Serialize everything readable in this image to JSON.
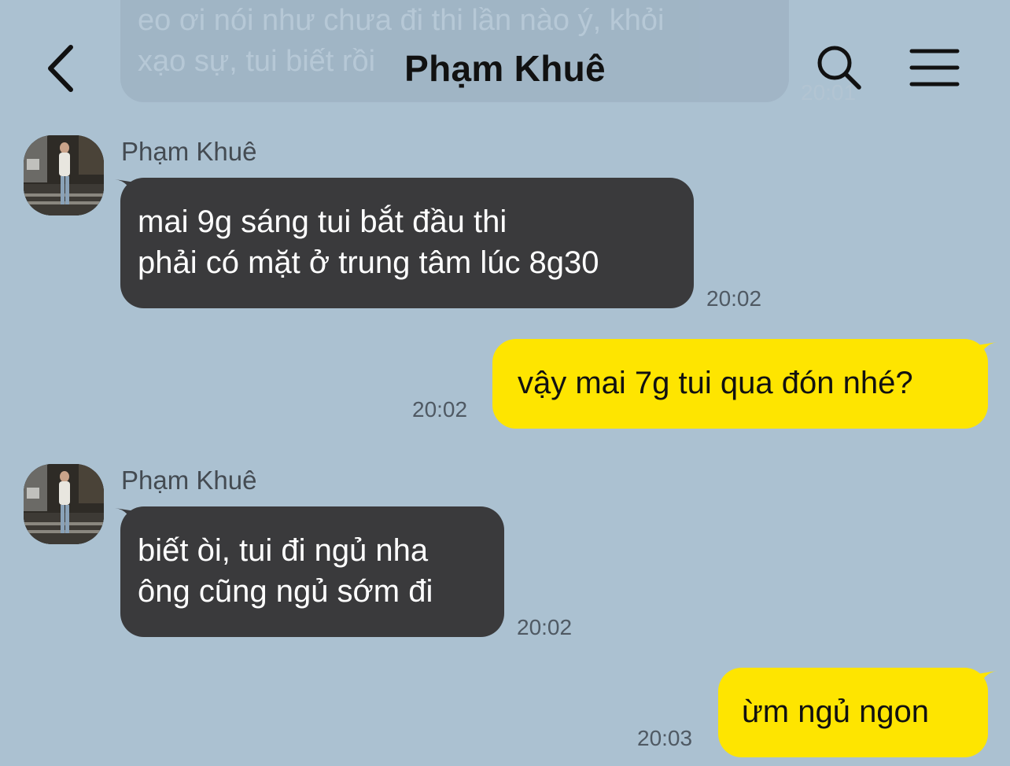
{
  "header": {
    "title": "Phạm Khuê"
  },
  "previous_message": {
    "lines": [
      "eo ơi nói như chưa đi thi lần nào ý, khỏi",
      "xạo sự, tui biết rồi"
    ],
    "time": "20:01"
  },
  "messages": [
    {
      "direction": "in",
      "sender": "Phạm Khuê",
      "lines": [
        "mai 9g sáng tui bắt đầu thi",
        "phải có mặt ở trung tâm lúc 8g30"
      ],
      "time": "20:02"
    },
    {
      "direction": "out",
      "lines": [
        "vậy mai 7g tui qua đón nhé?"
      ],
      "time": "20:02"
    },
    {
      "direction": "in",
      "sender": "Phạm Khuê",
      "lines": [
        "biết òi, tui đi ngủ nha",
        "ông cũng ngủ sớm đi"
      ],
      "time": "20:02"
    },
    {
      "direction": "out",
      "lines": [
        "ừm ngủ ngon"
      ],
      "time": "20:03"
    }
  ],
  "colors": {
    "background": "#abc1d1",
    "incoming_bubble": "#3a3a3c",
    "outgoing_bubble": "#fee500"
  },
  "icons": {
    "back": "chevron-left-icon",
    "search": "search-icon",
    "menu": "hamburger-menu-icon"
  }
}
